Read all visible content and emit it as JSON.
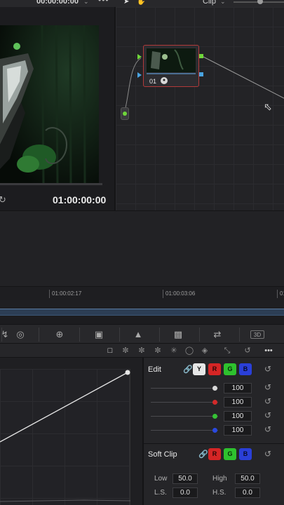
{
  "topbar": {
    "timecode": "00:00:00:00",
    "clip_label": "Clip"
  },
  "viewer": {
    "timecode": "01:00:00:00"
  },
  "node_editor": {
    "node_number": "01"
  },
  "timeline": {
    "marks": [
      "01:00:02:17",
      "01:00:03:06",
      "01"
    ]
  },
  "edit_panel": {
    "title": "Edit",
    "channels": {
      "y": "Y",
      "r": "R",
      "g": "G",
      "b": "B"
    },
    "values": [
      "100",
      "100",
      "100",
      "100"
    ],
    "dot_colors": [
      "#d8d8d8",
      "#d22a2a",
      "#35c235",
      "#2a49e0"
    ],
    "soft_clip": {
      "title": "Soft Clip",
      "low_label": "Low",
      "low_value": "50.0",
      "high_label": "High",
      "high_value": "50.0",
      "ls_label": "L.S.",
      "ls_value": "0.0",
      "hs_label": "H.S.",
      "hs_value": "0.0"
    }
  },
  "colors": {
    "accent_red": "#b23a3a",
    "node_port_green": "#6fd63a",
    "node_port_blue": "#4aa3e0"
  },
  "icons": {
    "palette": [
      "curves-icon",
      "qualifier-icon",
      "window-icon",
      "tracker-icon",
      "magic-mask-icon",
      "blur-icon",
      "key-icon",
      "sizing-icon",
      "3d-icon"
    ],
    "subbar": [
      "custom-curves-icon",
      "hue-vs-hue-icon",
      "hue-vs-sat-icon",
      "hue-vs-lum-icon",
      "lum-vs-sat-icon",
      "sat-vs-sat-icon",
      "sat-vs-lum-icon",
      "expand-icon",
      "reset-icon",
      "more-icon"
    ]
  }
}
